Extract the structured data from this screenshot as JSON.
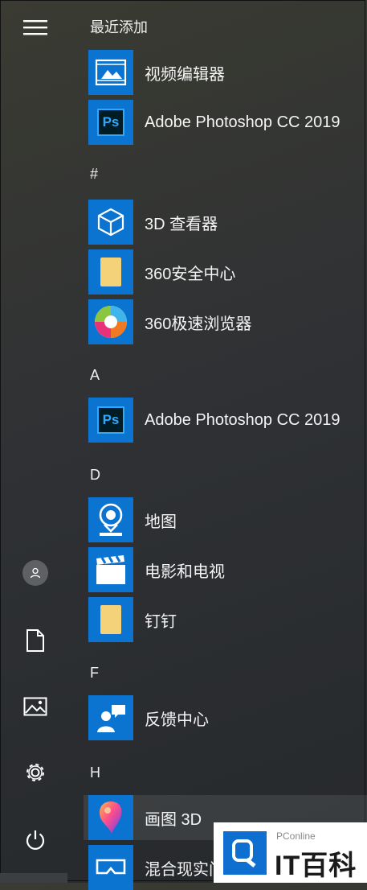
{
  "rail": {
    "items": [
      {
        "name": "menu-icon"
      },
      {
        "name": "user-icon"
      },
      {
        "name": "documents-icon"
      },
      {
        "name": "pictures-icon"
      },
      {
        "name": "settings-icon"
      },
      {
        "name": "power-icon"
      }
    ]
  },
  "list": {
    "recent_header": "最近添加",
    "headers": {
      "hash": "#",
      "a": "A",
      "d": "D",
      "f": "F",
      "h": "H"
    },
    "apps": {
      "video_editor": "视频编辑器",
      "ps_recent": "Adobe Photoshop CC 2019",
      "viewer_3d": "3D 查看器",
      "safe_360": "360安全中心",
      "browser_360": "360极速浏览器",
      "ps_a": "Adobe Photoshop CC 2019",
      "maps": "地图",
      "movies_tv": "电影和电视",
      "dingtalk": "钉钉",
      "feedback": "反馈中心",
      "paint3d": "画图 3D",
      "mixed_reality": "混合现实门户"
    },
    "ps_icon_text": "Ps"
  },
  "watermark": {
    "small": "PConline",
    "big": "IT百科"
  },
  "colors": {
    "tile_blue": "#0b73d0",
    "folder_yellow": "#f4d27a"
  }
}
